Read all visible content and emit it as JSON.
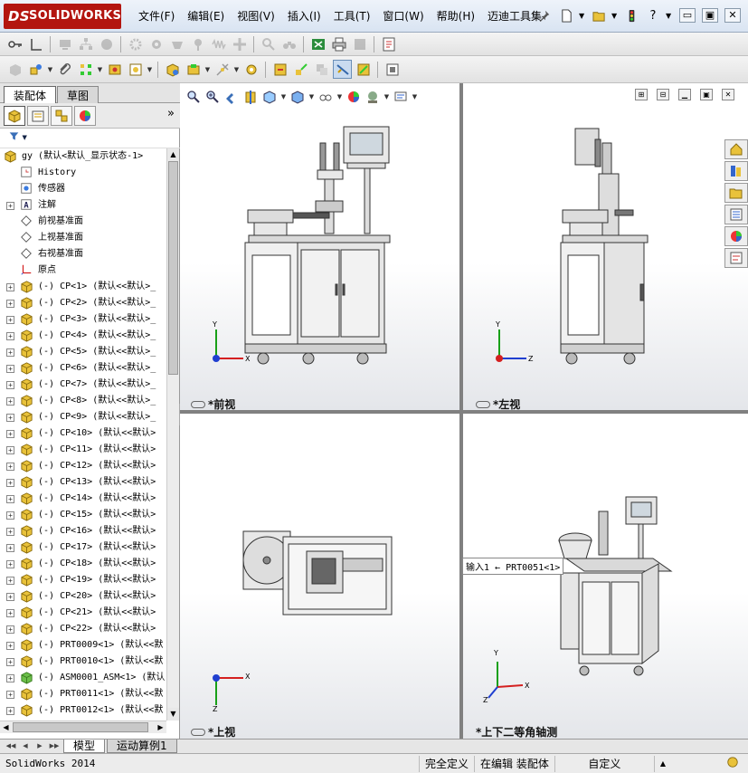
{
  "logo": {
    "ds": "DS",
    "name": "SOLIDWORKS"
  },
  "menus": [
    "文件(F)",
    "编辑(E)",
    "视图(V)",
    "插入(I)",
    "工具(T)",
    "窗口(W)",
    "帮助(H)",
    "迈迪工具集"
  ],
  "title_buttons": {
    "help": "?",
    "minimize": "▭",
    "restore": "▣",
    "close": "✕"
  },
  "panel_tabs": [
    "装配体",
    "草图"
  ],
  "mgr_expand": "»",
  "filter": "▼",
  "tree": [
    {
      "label": "gy  (默认<默认_显示状态-1>",
      "icon": "assembly-icon",
      "exp": "",
      "indent": 0
    },
    {
      "label": "History",
      "icon": "history-icon",
      "exp": "",
      "indent": 1
    },
    {
      "label": "传感器",
      "icon": "sensor-icon",
      "exp": "",
      "indent": 1
    },
    {
      "label": "注解",
      "icon": "annotation-icon",
      "exp": "+",
      "indent": 1
    },
    {
      "label": "前视基准面",
      "icon": "plane-icon",
      "exp": "",
      "indent": 1
    },
    {
      "label": "上视基准面",
      "icon": "plane-icon",
      "exp": "",
      "indent": 1
    },
    {
      "label": "右视基准面",
      "icon": "plane-icon",
      "exp": "",
      "indent": 1
    },
    {
      "label": "原点",
      "icon": "origin-icon",
      "exp": "",
      "indent": 1
    },
    {
      "label": "(-) CP<1> (默认<<默认>_",
      "icon": "subassembly-icon",
      "exp": "+",
      "indent": 1
    },
    {
      "label": "(-) CP<2> (默认<<默认>_",
      "icon": "subassembly-icon",
      "exp": "+",
      "indent": 1
    },
    {
      "label": "(-) CP<3> (默认<<默认>_",
      "icon": "subassembly-icon",
      "exp": "+",
      "indent": 1
    },
    {
      "label": "(-) CP<4> (默认<<默认>_",
      "icon": "subassembly-icon",
      "exp": "+",
      "indent": 1
    },
    {
      "label": "(-) CP<5> (默认<<默认>_",
      "icon": "subassembly-icon",
      "exp": "+",
      "indent": 1
    },
    {
      "label": "(-) CP<6> (默认<<默认>_",
      "icon": "subassembly-icon",
      "exp": "+",
      "indent": 1
    },
    {
      "label": "(-) CP<7> (默认<<默认>_",
      "icon": "subassembly-icon",
      "exp": "+",
      "indent": 1
    },
    {
      "label": "(-) CP<8> (默认<<默认>_",
      "icon": "subassembly-icon",
      "exp": "+",
      "indent": 1
    },
    {
      "label": "(-) CP<9> (默认<<默认>_",
      "icon": "subassembly-icon",
      "exp": "+",
      "indent": 1
    },
    {
      "label": "(-) CP<10> (默认<<默认>",
      "icon": "subassembly-icon",
      "exp": "+",
      "indent": 1
    },
    {
      "label": "(-) CP<11> (默认<<默认>",
      "icon": "subassembly-icon",
      "exp": "+",
      "indent": 1
    },
    {
      "label": "(-) CP<12> (默认<<默认>",
      "icon": "subassembly-icon",
      "exp": "+",
      "indent": 1
    },
    {
      "label": "(-) CP<13> (默认<<默认>",
      "icon": "subassembly-icon",
      "exp": "+",
      "indent": 1
    },
    {
      "label": "(-) CP<14> (默认<<默认>",
      "icon": "subassembly-icon",
      "exp": "+",
      "indent": 1
    },
    {
      "label": "(-) CP<15> (默认<<默认>",
      "icon": "subassembly-icon",
      "exp": "+",
      "indent": 1
    },
    {
      "label": "(-) CP<16> (默认<<默认>",
      "icon": "subassembly-icon",
      "exp": "+",
      "indent": 1
    },
    {
      "label": "(-) CP<17> (默认<<默认>",
      "icon": "subassembly-icon",
      "exp": "+",
      "indent": 1
    },
    {
      "label": "(-) CP<18> (默认<<默认>",
      "icon": "subassembly-icon",
      "exp": "+",
      "indent": 1
    },
    {
      "label": "(-) CP<19> (默认<<默认>",
      "icon": "subassembly-icon",
      "exp": "+",
      "indent": 1
    },
    {
      "label": "(-) CP<20> (默认<<默认>",
      "icon": "subassembly-icon",
      "exp": "+",
      "indent": 1
    },
    {
      "label": "(-) CP<21> (默认<<默认>",
      "icon": "subassembly-icon",
      "exp": "+",
      "indent": 1
    },
    {
      "label": "(-) CP<22> (默认<<默认>",
      "icon": "subassembly-icon",
      "exp": "+",
      "indent": 1
    },
    {
      "label": "(-) PRT0009<1> (默认<<默",
      "icon": "subassembly-icon",
      "exp": "+",
      "indent": 1
    },
    {
      "label": "(-) PRT0010<1> (默认<<默",
      "icon": "subassembly-icon",
      "exp": "+",
      "indent": 1
    },
    {
      "label": "(-) ASM0001_ASM<1> (默认",
      "icon": "subassembly-green-icon",
      "exp": "+",
      "indent": 1
    },
    {
      "label": "(-) PRT0011<1> (默认<<默",
      "icon": "subassembly-icon",
      "exp": "+",
      "indent": 1
    },
    {
      "label": "(-) PRT0012<1> (默认<<默",
      "icon": "subassembly-icon",
      "exp": "+",
      "indent": 1
    }
  ],
  "viewports": [
    {
      "label": "*前视"
    },
    {
      "label": "*左视"
    },
    {
      "label": "*上视"
    },
    {
      "label": "*上下二等角轴测"
    }
  ],
  "axis": {
    "x": "X",
    "y": "Y",
    "z": "Z"
  },
  "callout": "输入1 ← PRT0051<1>",
  "bottom_tabs": [
    "模型",
    "运动算例1"
  ],
  "status": {
    "app": "SolidWorks 2014",
    "defined": "完全定义",
    "editing": "在编辑 装配体",
    "custom": "自定义"
  },
  "colors": {
    "brand": "#b3150f",
    "xaxis": "#d42020",
    "yaxis": "#18a018",
    "zaxis": "#1f3fd0"
  }
}
